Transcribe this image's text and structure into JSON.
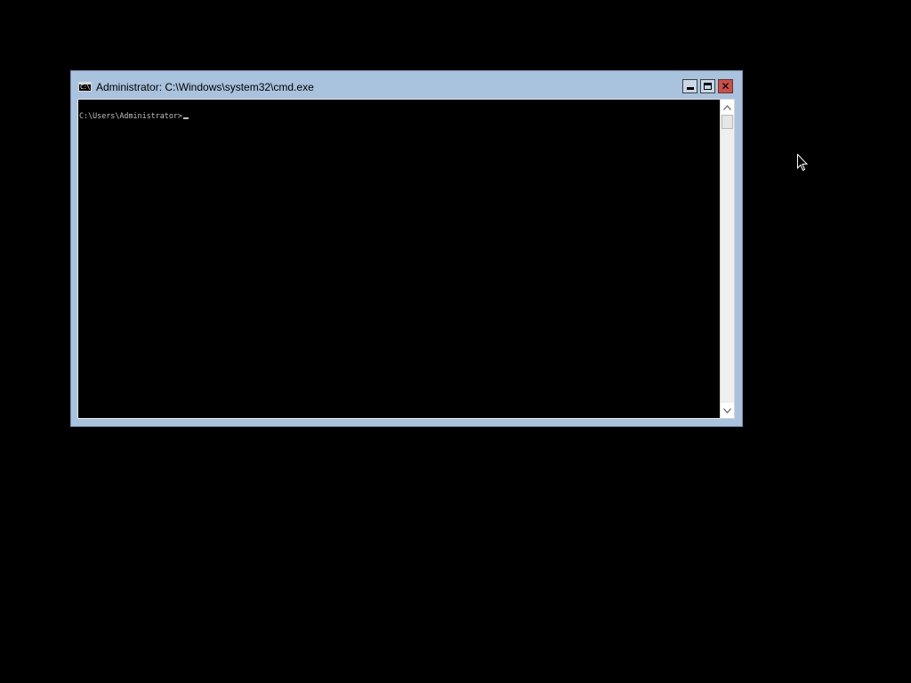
{
  "window": {
    "title": "Administrator: C:\\Windows\\system32\\cmd.exe",
    "icon": "cmd-icon",
    "icon_glyph": "C:\\",
    "buttons": {
      "minimize": "minimize-icon",
      "maximize": "maximize-icon",
      "close": "close-icon",
      "close_glyph": "✕"
    },
    "colors": {
      "frame": "#a9c2dd",
      "close_button": "#c7504a",
      "console_background": "#000000",
      "console_text": "#c0c0c0"
    }
  },
  "console": {
    "prompt": "C:\\Users\\Administrator>"
  },
  "scrollbar": {
    "up_icon": "chevron-up-icon",
    "down_icon": "chevron-down-icon"
  },
  "desktop": {
    "background": "#000000",
    "pointer_icon": "arrow-pointer-icon"
  }
}
